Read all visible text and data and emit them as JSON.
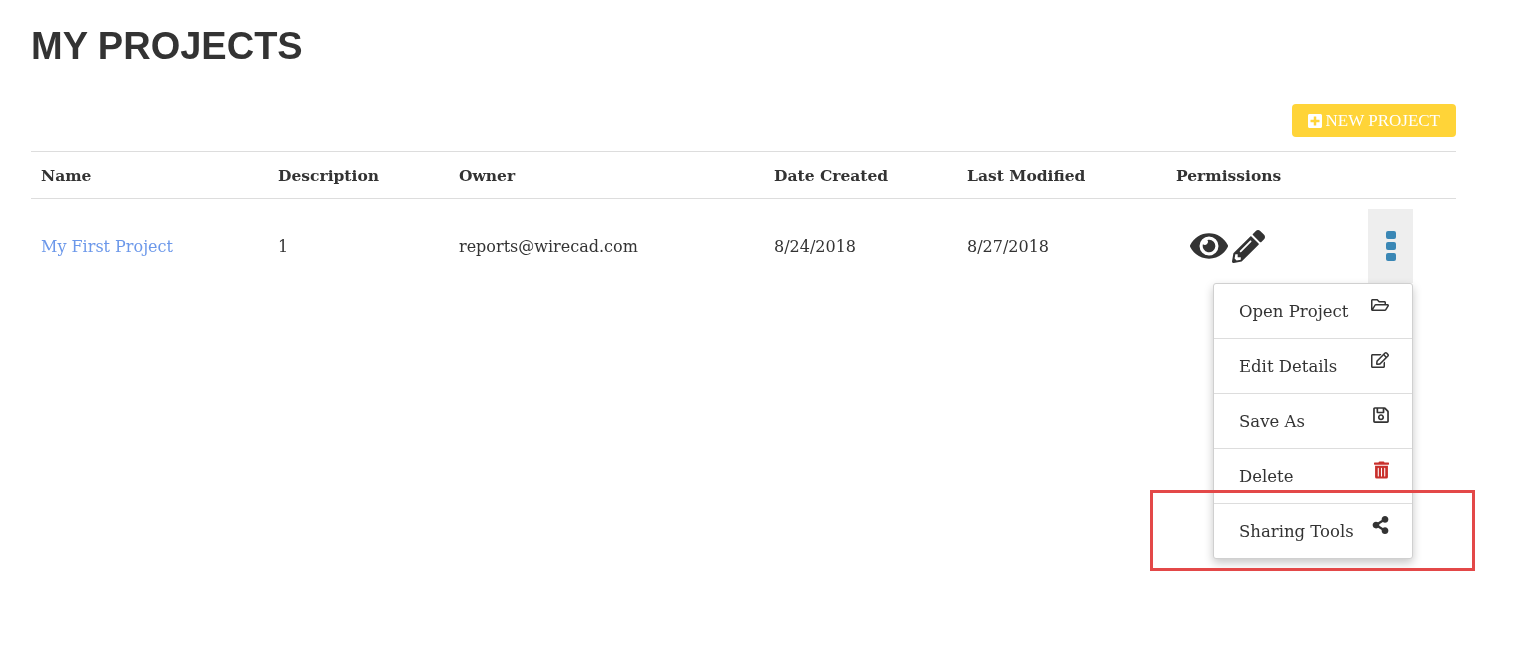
{
  "page": {
    "title": "MY PROJECTS"
  },
  "toolbar": {
    "new_button": {
      "label": "NEW PROJECT"
    }
  },
  "table": {
    "columns": [
      "Name",
      "Description",
      "Owner",
      "Date Created",
      "Last Modified",
      "Permissions"
    ],
    "rows": [
      {
        "name": "My First Project",
        "description": "1",
        "owner": "reports@wirecad.com",
        "date_created": "8/24/2018",
        "last_modified": "8/27/2018",
        "permissions": {
          "view": true,
          "edit": true
        },
        "menu": {
          "open": true,
          "items": [
            {
              "label": "Open Project",
              "kind": "open",
              "highlighted": false
            },
            {
              "label": "Edit Details",
              "kind": "edit",
              "highlighted": false
            },
            {
              "label": "Save As",
              "kind": "save",
              "highlighted": false
            },
            {
              "label": "Delete",
              "kind": "delete",
              "highlighted": false
            },
            {
              "label": "Sharing Tools",
              "kind": "share",
              "highlighted": true
            }
          ]
        }
      }
    ]
  }
}
